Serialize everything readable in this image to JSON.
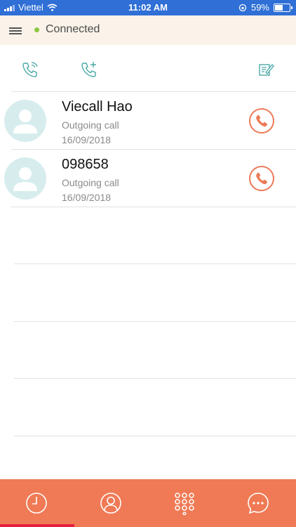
{
  "status_bar": {
    "carrier": "Viettel",
    "time": "11:02 AM",
    "battery": "59%",
    "battery_level": 0.59,
    "bg_color": "#2f6fd6"
  },
  "header": {
    "status_text": "Connected",
    "status_color": "#8cc63f",
    "bg_color": "#fbf3e9"
  },
  "toolbar": {
    "icons": [
      "phone-call-icon",
      "add-call-icon",
      "edit-icon"
    ]
  },
  "calls": [
    {
      "name": "Viecall Hao",
      "type": "Outgoing call",
      "date": "16/09/2018"
    },
    {
      "name": "098658",
      "type": "Outgoing call",
      "date": "16/09/2018"
    }
  ],
  "bottom_nav": {
    "items": [
      "recent-clock-icon",
      "contacts-icon",
      "dialpad-icon",
      "chat-icon"
    ],
    "active": 0,
    "bg_color": "#ef7a55"
  },
  "accent_color": "#ec7a57"
}
